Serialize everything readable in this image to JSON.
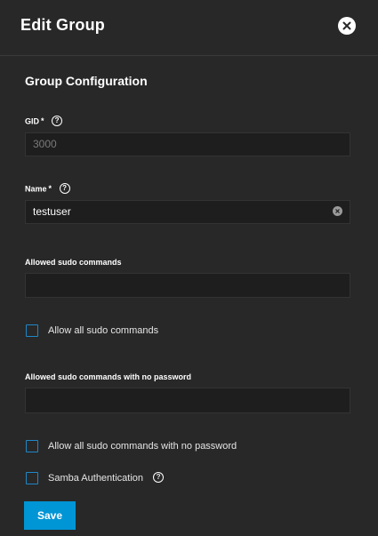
{
  "dialog": {
    "title": "Edit Group",
    "section_title": "Group Configuration"
  },
  "fields": {
    "gid": {
      "label": "GID",
      "required_mark": "*",
      "value": "3000"
    },
    "name": {
      "label": "Name",
      "required_mark": "*",
      "value": "testuser"
    },
    "sudo_commands": {
      "label": "Allowed sudo commands",
      "value": ""
    },
    "sudo_nopasswd": {
      "label": "Allowed sudo commands with no password",
      "value": ""
    }
  },
  "checkboxes": {
    "allow_all_sudo": {
      "label": "Allow all sudo commands",
      "checked": false
    },
    "allow_all_sudo_nopasswd": {
      "label": "Allow all sudo commands with no password",
      "checked": false
    },
    "samba_auth": {
      "label": "Samba Authentication",
      "checked": false
    }
  },
  "actions": {
    "save_label": "Save"
  },
  "colors": {
    "accent": "#0095d5",
    "checkbox_border": "#1f87c6",
    "background": "#282828"
  },
  "icons": {
    "close": "close-icon",
    "help": "help-icon",
    "clear": "clear-icon"
  }
}
